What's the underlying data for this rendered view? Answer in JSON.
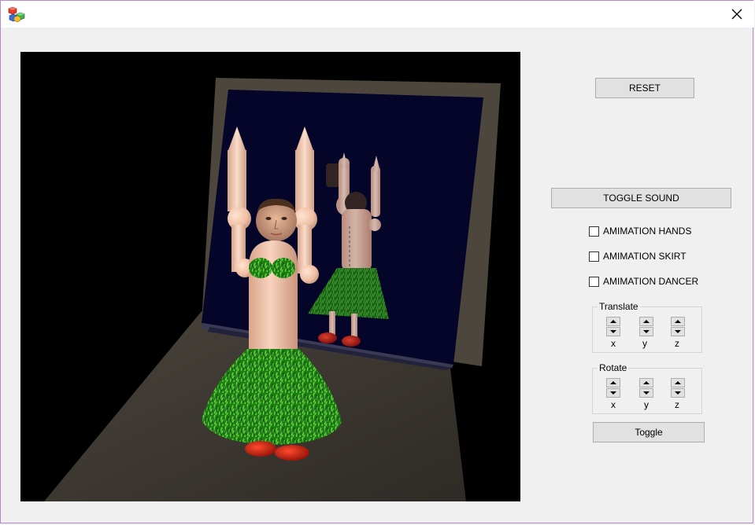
{
  "window": {
    "title": "",
    "app_icon": "app-cubes-icon",
    "close_icon": "close-icon"
  },
  "scene": {
    "description_icon": "3d-viewport"
  },
  "controls": {
    "reset_label": "RESET",
    "toggle_sound_label": "TOGGLE SOUND",
    "checkboxes": [
      {
        "label": "AMIMATION HANDS",
        "checked": false
      },
      {
        "label": "AMIMATION SKIRT",
        "checked": false
      },
      {
        "label": "AMIMATION DANCER",
        "checked": false
      }
    ],
    "translate": {
      "title": "Translate",
      "axes": [
        "x",
        "y",
        "z"
      ]
    },
    "rotate": {
      "title": "Rotate",
      "axes": [
        "x",
        "y",
        "z"
      ]
    },
    "toggle_label": "Toggle"
  },
  "colors": {
    "window_border": "#b589c7",
    "panel_bg": "#f0f0f0",
    "button_bg": "#e1e1e1",
    "skin": "#f2c3a8",
    "grass": "#2e9a1e",
    "shoes": "#c0180c",
    "mirror": "#06062a",
    "floor": "#3f3a33"
  }
}
